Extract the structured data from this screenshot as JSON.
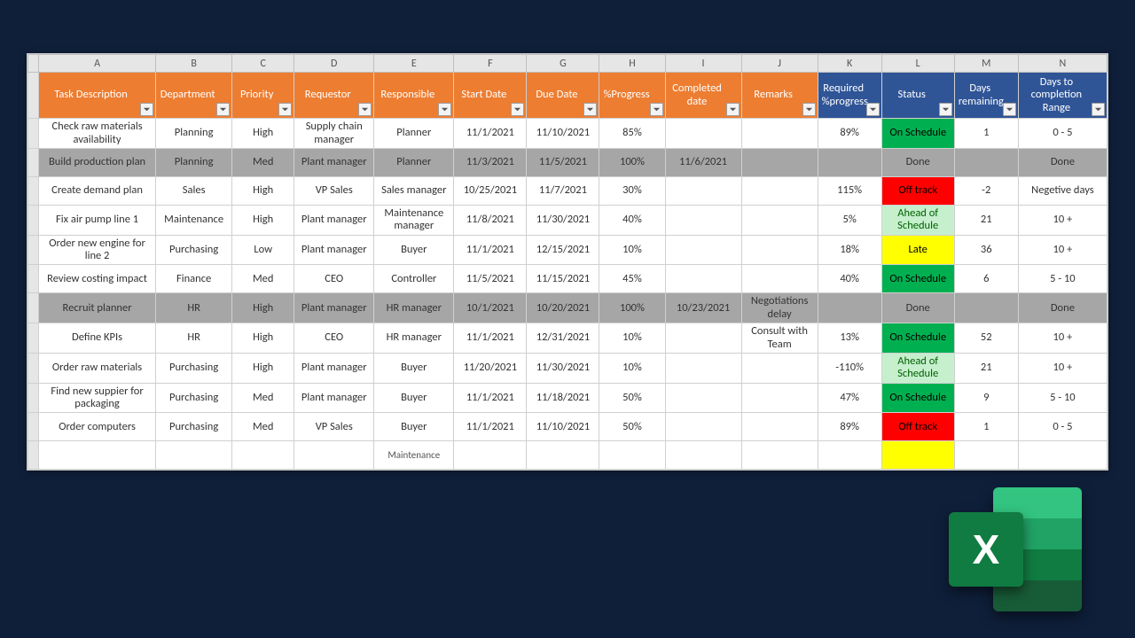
{
  "columns": {
    "letters": [
      "A",
      "B",
      "C",
      "D",
      "E",
      "F",
      "G",
      "H",
      "I",
      "J",
      "K",
      "L",
      "M",
      "N"
    ],
    "widths": [
      132,
      86,
      70,
      90,
      90,
      82,
      82,
      74,
      86,
      86,
      72,
      82,
      72,
      100
    ],
    "headers": [
      {
        "label": "Task Description",
        "group": "orange"
      },
      {
        "label": "Department",
        "group": "orange"
      },
      {
        "label": "Priority",
        "group": "orange"
      },
      {
        "label": "Requestor",
        "group": "orange"
      },
      {
        "label": "Responsible",
        "group": "orange"
      },
      {
        "label": "Start Date",
        "group": "orange"
      },
      {
        "label": "Due Date",
        "group": "orange"
      },
      {
        "label": "%Progress",
        "group": "orange"
      },
      {
        "label": "Completed date",
        "group": "orange"
      },
      {
        "label": "Remarks",
        "group": "orange"
      },
      {
        "label": "Required %progress",
        "group": "blue"
      },
      {
        "label": "Status",
        "group": "blue"
      },
      {
        "label": "Days remaining",
        "group": "blue"
      },
      {
        "label": "Days to completion Range",
        "group": "blue"
      }
    ]
  },
  "rows": [
    {
      "done": false,
      "cells": [
        "Check raw materials availability",
        "Planning",
        "High",
        "Supply chain manager",
        "Planner",
        "11/1/2021",
        "11/10/2021",
        "85%",
        "",
        "",
        "89%",
        "On Schedule",
        "1",
        "0 - 5"
      ],
      "statusClass": "st-green"
    },
    {
      "done": true,
      "cells": [
        "Build production plan",
        "Planning",
        "Med",
        "Plant manager",
        "Planner",
        "11/3/2021",
        "11/5/2021",
        "100%",
        "11/6/2021",
        "",
        "",
        "Done",
        "",
        "Done"
      ],
      "statusClass": "st-none"
    },
    {
      "done": false,
      "cells": [
        "Create demand plan",
        "Sales",
        "High",
        "VP Sales",
        "Sales manager",
        "10/25/2021",
        "11/7/2021",
        "30%",
        "",
        "",
        "115%",
        "Off track",
        "-2",
        "Negetive days"
      ],
      "statusClass": "st-red"
    },
    {
      "done": false,
      "cells": [
        "Fix air pump line 1",
        "Maintenance",
        "High",
        "Plant manager",
        "Maintenance manager",
        "11/8/2021",
        "11/30/2021",
        "40%",
        "",
        "",
        "5%",
        "Ahead of Schedule",
        "21",
        "10 +"
      ],
      "statusClass": "st-lgreen"
    },
    {
      "done": false,
      "cells": [
        "Order new engine for line 2",
        "Purchasing",
        "Low",
        "Plant manager",
        "Buyer",
        "11/1/2021",
        "12/15/2021",
        "10%",
        "",
        "",
        "18%",
        "Late",
        "36",
        "10 +"
      ],
      "statusClass": "st-yellow"
    },
    {
      "done": false,
      "cells": [
        "Review costing impact",
        "Finance",
        "Med",
        "CEO",
        "Controller",
        "11/5/2021",
        "11/15/2021",
        "45%",
        "",
        "",
        "40%",
        "On Schedule",
        "6",
        "5 - 10"
      ],
      "statusClass": "st-green"
    },
    {
      "done": true,
      "cells": [
        "Recruit planner",
        "HR",
        "High",
        "Plant manager",
        "HR manager",
        "10/1/2021",
        "10/20/2021",
        "100%",
        "10/23/2021",
        "Negotiations delay",
        "",
        "Done",
        "",
        "Done"
      ],
      "statusClass": "st-none"
    },
    {
      "done": false,
      "cells": [
        "Define KPIs",
        "HR",
        "High",
        "CEO",
        "HR manager",
        "11/1/2021",
        "12/31/2021",
        "10%",
        "",
        "Consult with Team",
        "13%",
        "On Schedule",
        "52",
        "10 +"
      ],
      "statusClass": "st-green"
    },
    {
      "done": false,
      "cells": [
        "Order raw materials",
        "Purchasing",
        "High",
        "Plant manager",
        "Buyer",
        "11/20/2021",
        "11/30/2021",
        "10%",
        "",
        "",
        "-110%",
        "Ahead of Schedule",
        "21",
        "10 +"
      ],
      "statusClass": "st-lgreen"
    },
    {
      "done": false,
      "cells": [
        "Find new suppier for packaging",
        "Purchasing",
        "Med",
        "Plant manager",
        "Buyer",
        "11/1/2021",
        "11/18/2021",
        "50%",
        "",
        "",
        "47%",
        "On Schedule",
        "9",
        "5 - 10"
      ],
      "statusClass": "st-green"
    },
    {
      "done": false,
      "cells": [
        "Order computers",
        "Purchasing",
        "Med",
        "VP Sales",
        "Buyer",
        "11/1/2021",
        "11/10/2021",
        "50%",
        "",
        "",
        "89%",
        "Off track",
        "1",
        "0 - 5"
      ],
      "statusClass": "st-red"
    }
  ],
  "partial_row": [
    "",
    "",
    "",
    "",
    "Maintenance",
    "",
    "",
    "",
    "",
    "",
    "",
    "",
    "",
    ""
  ],
  "logo": {
    "letter": "X"
  }
}
